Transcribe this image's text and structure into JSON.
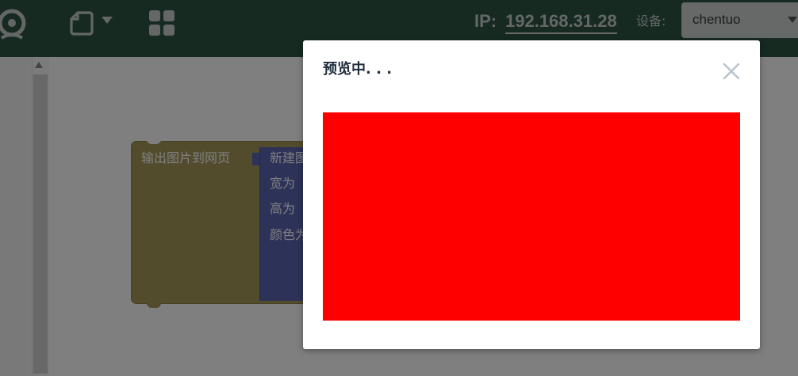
{
  "topbar": {
    "logo_icon": "webcam-logo-icon",
    "file_icon": "file-icon",
    "file_menu_icon": "chevron-down-icon",
    "apps_icon": "grid-icon",
    "ip_label": "IP:",
    "ip_value": "192.168.31.28",
    "device_label": "设备:",
    "device_selected": "chentuo",
    "bg_color": "#2c5545"
  },
  "workspace": {
    "blocks": {
      "output_image_label": "输出图片到网页",
      "new_image_label": "新建图",
      "width_label": "宽为",
      "height_label": "高为",
      "color_label": "颜色为"
    }
  },
  "modal": {
    "title": "预览中. . .",
    "close_icon": "close-icon",
    "preview_color": "#ff0000"
  }
}
